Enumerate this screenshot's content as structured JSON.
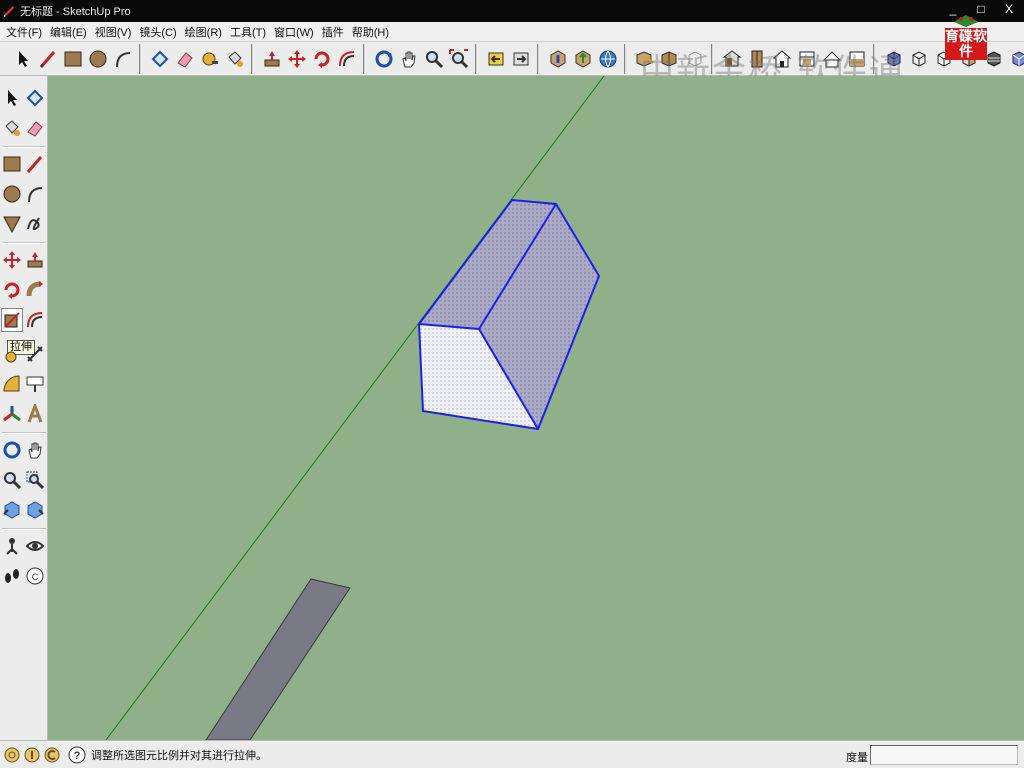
{
  "window": {
    "title": "无标题 - SketchUp Pro",
    "controls": [
      "_",
      "□",
      "X"
    ]
  },
  "menu": {
    "items": [
      "文件(F)",
      "编辑(E)",
      "视图(V)",
      "镜头(C)",
      "绘图(R)",
      "工具(T)",
      "窗口(W)",
      "插件",
      "帮助(H)"
    ]
  },
  "watermark": {
    "text": "中新金桥 软件通",
    "logo_text": "育碟软件"
  },
  "toolbar_top": {
    "icons": [
      "select-icon",
      "line-icon",
      "rectangle-icon",
      "circle-icon",
      "arc-icon",
      "make-component-icon",
      "eraser-icon",
      "tape-measure-icon",
      "paint-bucket-icon",
      "push-pull-icon",
      "move-icon",
      "rotate-icon",
      "offset-icon",
      "orbit-icon",
      "pan-icon",
      "zoom-icon",
      "zoom-extents-icon",
      "previous-view-icon",
      "next-view-icon",
      "get-models-icon",
      "share-model-icon",
      "share-component-icon",
      "3d-warehouse-icon",
      "component-icon",
      "section-icon",
      "iso-view-icon",
      "top-view-icon",
      "front-view-icon",
      "right-view-icon",
      "back-view-icon",
      "left-view-icon",
      "xray-icon",
      "wireframe-icon",
      "hidden-line-icon",
      "shaded-icon",
      "shaded-texture-icon",
      "monochrome-icon",
      "section-fill-icon"
    ]
  },
  "toolbar_left": {
    "tooltip": "拉伸"
  },
  "status": {
    "hint": "调整所选图元比例并对其进行拉伸。",
    "measure_label": "度量",
    "measure_value": ""
  },
  "colors": {
    "viewport_bg": "#8fb088",
    "selection": "#1a22e6",
    "axis_green": "#1d7a1d"
  }
}
